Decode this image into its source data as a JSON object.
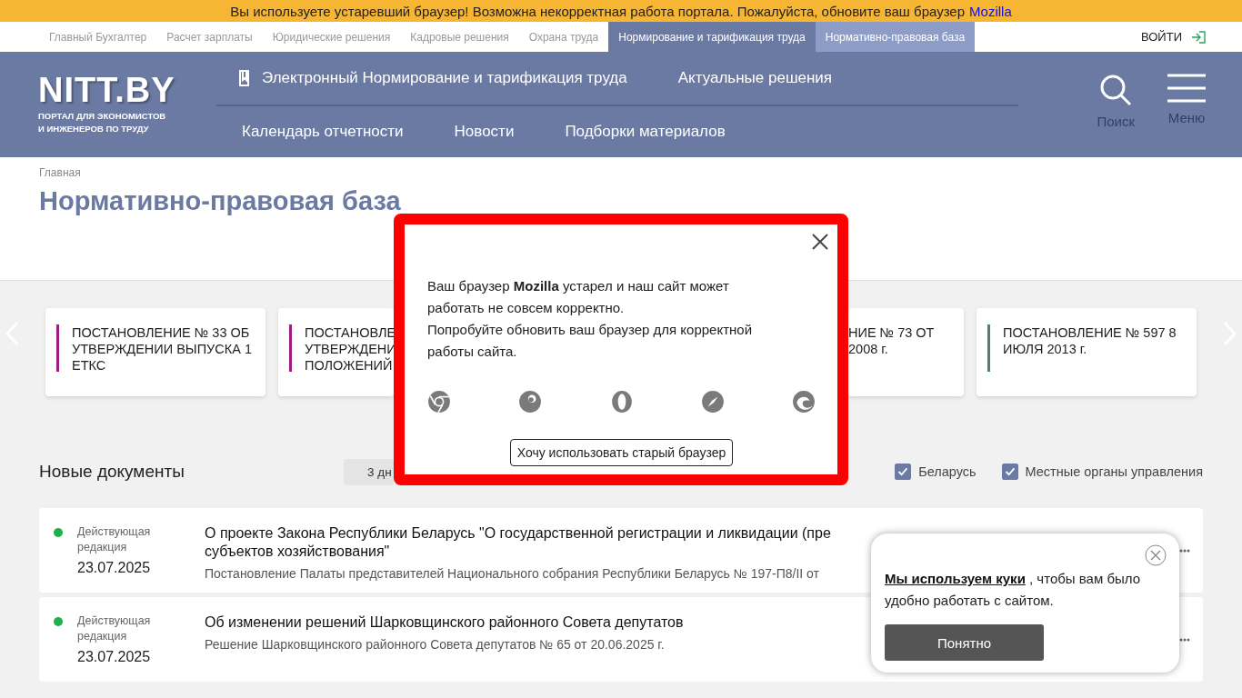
{
  "banner": {
    "text": "Вы используете устаревший браузер! Возможна некорректная работа портала. Пожалуйста, обновите ваш браузер",
    "link": "Mozilla"
  },
  "top_nav": {
    "items": [
      {
        "label": "Главный Бухгалтер",
        "current_site": false,
        "selected": false
      },
      {
        "label": "Расчет зарплаты",
        "current_site": false,
        "selected": false
      },
      {
        "label": "Юридические решения",
        "current_site": false,
        "selected": false
      },
      {
        "label": "Кадровые решения",
        "current_site": false,
        "selected": false
      },
      {
        "label": "Охрана труда",
        "current_site": false,
        "selected": false
      },
      {
        "label": "Нормирование и тарификация труда",
        "current_site": true,
        "selected": false
      },
      {
        "label": "Нормативно-правовая база",
        "current_site": false,
        "selected": true
      }
    ],
    "login": "ВОЙТИ"
  },
  "header": {
    "logo": "NITT.BY",
    "tagline": "ПОРТАЛ ДЛЯ ЭКОНОМИСТОВ\nИ ИНЖЕНЕРОВ ПО ТРУДУ",
    "nav_top": [
      "Электронный Нормирование и тарификация труда",
      "Актуальные решения"
    ],
    "nav_bottom": [
      "Календарь отчетности",
      "Новости",
      "Подборки материалов"
    ],
    "search": "Поиск",
    "menu": "Меню"
  },
  "breadcrumb": "Главная",
  "page_title": "Нормативно-правовая база",
  "cards": [
    {
      "kind": "full",
      "text": "ПОСТАНОВЛЕНИЕ № 33 ОБ УТВЕРЖДЕНИИ ВЫПУСКА 1 ЕТКС",
      "color": "#9c1c84"
    },
    {
      "kind": "cut_right",
      "text": "ПОСТАНОВЛЕ\nУТВЕРЖДЕНИ\nПОЛОЖЕНИЙ",
      "color": "#9c1c84"
    },
    {
      "kind": "cut_left",
      "text": "НИЕ № 73 ОТ\n2008 г."
    },
    {
      "kind": "full",
      "text": "ПОСТАНОВЛЕНИЕ № 597 8 ИЮЛЯ 2013 г.",
      "color": "#5e7a6a"
    }
  ],
  "new_docs": {
    "title": "Новые документы",
    "period_tab": "3 дн",
    "filters": [
      {
        "label": "Беларусь",
        "checked": true
      },
      {
        "label": "Местные органы управления",
        "checked": true
      }
    ],
    "rows": [
      {
        "status": "Действующая\nредакция",
        "color": "#1fb04a",
        "date": "23.07.2025",
        "title": "О проекте Закона Республики Беларусь \"О государственной регистрации и ликвидации (пре\nсубъектов хозяйствования\"",
        "subtitle": "Постановление Палаты представителей Национального собрания Республики Беларусь № 197-П8/II от"
      },
      {
        "status": "Действующая\nредакция",
        "color": "#1fb04a",
        "date": "23.07.2025",
        "title": "Об изменении решений Шарковщинского районного Совета депутатов",
        "subtitle": "Решение Шарковщинского районного Совета депутатов № 65 от 20.06.2025 г."
      }
    ]
  },
  "modal": {
    "text": "Ваш браузер **Mozilla** устарел и наш сайт может работать не совсем корректно.\nПопробуйте обновить ваш браузер для корректной работы сайта.",
    "button": "Хочу использовать старый браузер"
  },
  "cookie": {
    "link": "Мы используем куки",
    "text": " , чтобы вам было удобно работать с сайтом.",
    "button": "Понятно"
  }
}
